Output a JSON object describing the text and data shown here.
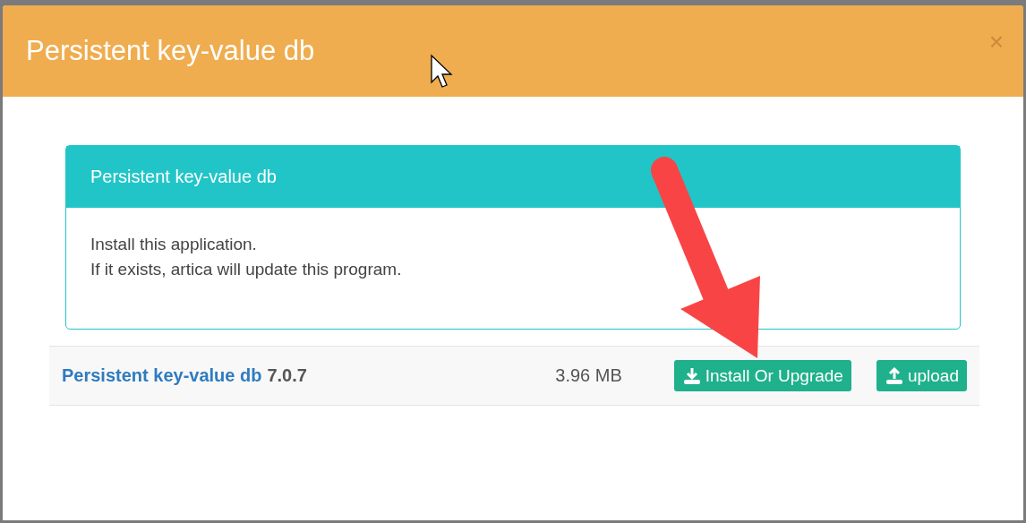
{
  "dialog": {
    "title": "Persistent key-value db",
    "close": "×"
  },
  "panel": {
    "title": "Persistent key-value db",
    "lines": [
      "Install this application.",
      "If it exists, artica will update this program."
    ]
  },
  "package": {
    "name": "Persistent key-value db",
    "version": "7.0.7",
    "size": "3.96 MB",
    "buttons": [
      {
        "label": "Install Or Upgrade",
        "kind": "download"
      },
      {
        "label": "upload",
        "kind": "upload"
      }
    ]
  }
}
